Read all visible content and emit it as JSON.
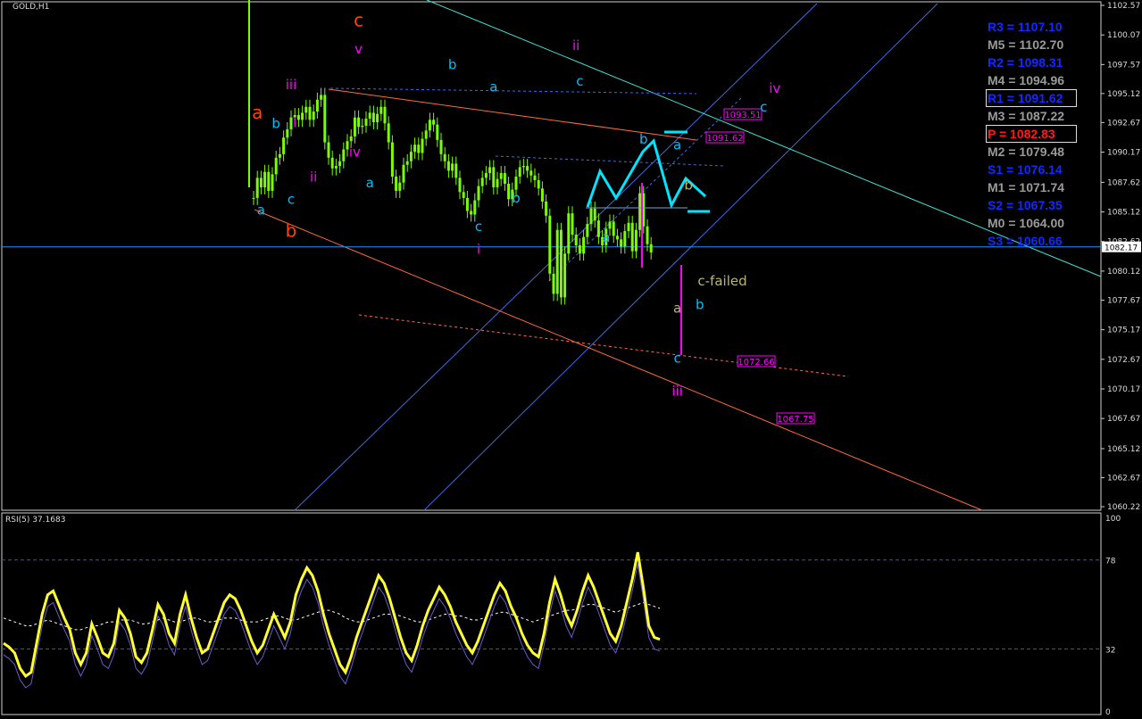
{
  "window": {
    "symbol_title": "GOLD,H1",
    "rsi_title": "RSI(5) 37.1683"
  },
  "colors": {
    "background": "#000000",
    "candle": "#7cfc00",
    "price_line": "#1e90ff",
    "channel": "#4169e1",
    "fan": "#40e0d0",
    "orange_line": "#ff6a3d",
    "wave_cyan": "#00bfff",
    "wave_magenta": "#ff00ff",
    "wave_orange": "#ff4500",
    "rsi_main": "#ffff33",
    "rsi_signal": "#6a5acd",
    "arrow": "#00e5ff"
  },
  "pivots": [
    {
      "label": "R3 = 1107.10",
      "color": "#1428ff"
    },
    {
      "label": "M5 = 1102.70",
      "color": "#9a9a9a"
    },
    {
      "label": "R2 = 1098.31",
      "color": "#1428ff"
    },
    {
      "label": "M4 = 1094.96",
      "color": "#9a9a9a"
    },
    {
      "label": "R1 = 1091.62",
      "color": "#1428ff",
      "boxed": true
    },
    {
      "label": "M3 = 1087.22",
      "color": "#9a9a9a"
    },
    {
      "label": "P = 1082.83",
      "color": "#ff1a1a",
      "boxed": true
    },
    {
      "label": "M2 = 1079.48",
      "color": "#9a9a9a"
    },
    {
      "label": "S1 = 1076.14",
      "color": "#1428ff"
    },
    {
      "label": "M1 = 1071.74",
      "color": "#9a9a9a"
    },
    {
      "label": "S2 = 1067.35",
      "color": "#1428ff"
    },
    {
      "label": "M0 = 1064.00",
      "color": "#9a9a9a"
    },
    {
      "label": "S3 = 1060.66",
      "color": "#1428ff"
    }
  ],
  "chart_data": [
    {
      "type": "candlestick",
      "title": "GOLD,H1",
      "ylim": [
        1060.22,
        1102.57
      ],
      "y_ticks": [
        "1102.57",
        "1100.07",
        "1097.57",
        "1095.12",
        "1092.67",
        "1090.17",
        "1087.62",
        "1085.12",
        "1082.62",
        "1080.12",
        "1077.67",
        "1075.17",
        "1072.67",
        "1070.17",
        "1067.67",
        "1065.12",
        "1062.67",
        "1060.22"
      ],
      "current_price": "1082.17",
      "price_tags": [
        "1093.51",
        "1091.62",
        "1072.66",
        "1067.75"
      ],
      "wave_labels": [
        {
          "text": "c",
          "color": "#ff4500",
          "price": 1100.8,
          "bar": 28
        },
        {
          "text": "v",
          "color": "#ff00ff",
          "price": 1098.5,
          "bar": 28
        },
        {
          "text": "iii",
          "color": "#ff00ff",
          "price": 1095.5,
          "bar": 10
        },
        {
          "text": "ii",
          "color": "#ff00ff",
          "price": 1098.8,
          "bar": 86
        },
        {
          "text": "a",
          "color": "#ff4500",
          "price": 1093.0,
          "bar": 1
        },
        {
          "text": "b",
          "color": "#00bfff",
          "price": 1092.2,
          "bar": 6
        },
        {
          "text": "i",
          "color": "#ff00ff",
          "price": 1092.3,
          "bar": 11
        },
        {
          "text": "iv",
          "color": "#ff00ff",
          "price": 1089.8,
          "bar": 27
        },
        {
          "text": "ii",
          "color": "#ff00ff",
          "price": 1087.7,
          "bar": 16
        },
        {
          "text": "c",
          "color": "#00bfff",
          "price": 1085.8,
          "bar": 10
        },
        {
          "text": "a",
          "color": "#00bfff",
          "price": 1084.9,
          "bar": 2
        },
        {
          "text": "b",
          "color": "#ff4500",
          "price": 1083.0,
          "bar": 10
        },
        {
          "text": "b",
          "color": "#00bfff",
          "price": 1097.2,
          "bar": 53
        },
        {
          "text": "a",
          "color": "#00bfff",
          "price": 1095.3,
          "bar": 64
        },
        {
          "text": "c",
          "color": "#00bfff",
          "price": 1095.8,
          "bar": 87
        },
        {
          "text": "a",
          "color": "#00bfff",
          "price": 1087.2,
          "bar": 31
        },
        {
          "text": "b",
          "color": "#00bfff",
          "price": 1085.9,
          "bar": 70
        },
        {
          "text": "c",
          "color": "#00bfff",
          "price": 1083.5,
          "bar": 60
        },
        {
          "text": "i",
          "color": "#ff00ff",
          "price": 1081.6,
          "bar": 60
        },
        {
          "text": "b",
          "color": "#00bfff",
          "price": 1090.9,
          "bar": 104
        },
        {
          "text": "a",
          "color": "#00bfff",
          "price": 1082.6,
          "bar": 94
        },
        {
          "text": "a",
          "color": "#00bfff",
          "price": 1090.4,
          "bar": 113
        },
        {
          "text": "b",
          "color": "#bdb76b",
          "price": 1087.0,
          "bar": 116
        },
        {
          "text": "c-failed",
          "color": "#bdb76b",
          "price": 1078.9,
          "bar": 125
        },
        {
          "text": "a",
          "color": "#bdb76b",
          "price": 1076.6,
          "bar": 113
        },
        {
          "text": "b",
          "color": "#00bfff",
          "price": 1076.9,
          "bar": 119
        },
        {
          "text": "c",
          "color": "#00bfff",
          "price": 1072.4,
          "bar": 113
        },
        {
          "text": "iii",
          "color": "#ff00ff",
          "price": 1069.6,
          "bar": 113
        },
        {
          "text": "iv",
          "color": "#ff00ff",
          "price": 1095.2,
          "bar": 139
        },
        {
          "text": "c",
          "color": "#00bfff",
          "price": 1093.6,
          "bar": 136
        }
      ],
      "candles_close_path": [
        1086.3,
        1088.0,
        1087.2,
        1088.5,
        1086.9,
        1088.3,
        1089.7,
        1090.0,
        1091.4,
        1092.1,
        1093.1,
        1093.3,
        1092.9,
        1093.5,
        1094.0,
        1092.9,
        1093.6,
        1094.6,
        1095.0,
        1091.0,
        1089.7,
        1088.8,
        1089.0,
        1089.4,
        1090.4,
        1091.1,
        1091.5,
        1093.1,
        1092.3,
        1092.4,
        1093.0,
        1093.5,
        1092.7,
        1093.4,
        1094.0,
        1092.6,
        1091.0,
        1088.1,
        1086.9,
        1087.6,
        1089.1,
        1089.4,
        1090.2,
        1090.8,
        1090.1,
        1091.3,
        1092.0,
        1092.9,
        1092.5,
        1091.2,
        1090.0,
        1089.4,
        1088.6,
        1089.2,
        1088.0,
        1086.8,
        1086.3,
        1085.2,
        1084.9,
        1086.1,
        1087.3,
        1088.0,
        1088.4,
        1088.9,
        1087.2,
        1087.9,
        1088.4,
        1087.5,
        1086.2,
        1087.0,
        1088.1,
        1088.9,
        1089.0,
        1088.6,
        1088.2,
        1087.8,
        1087.1,
        1086.0,
        1084.8,
        1079.9,
        1078.2,
        1083.6,
        1077.9,
        1081.6,
        1085.0,
        1083.2,
        1082.3,
        1081.6,
        1083.0,
        1084.1,
        1085.4,
        1084.4,
        1083.0,
        1082.3,
        1083.7,
        1084.3,
        1083.1,
        1082.8,
        1082.2,
        1083.5,
        1084.2,
        1081.8,
        1083.6,
        1086.7,
        1083.9,
        1082.4,
        1081.7
      ],
      "rsi": {
        "title": "RSI(5) 37.1683",
        "ylim": [
          0,
          100
        ],
        "levels": [
          32,
          78
        ],
        "y_ticks": [
          "100",
          "78",
          "32",
          "0"
        ],
        "values": [
          35,
          33,
          30,
          22,
          18,
          20,
          35,
          50,
          60,
          62,
          55,
          48,
          42,
          30,
          24,
          30,
          45,
          38,
          30,
          28,
          35,
          52,
          48,
          40,
          28,
          25,
          30,
          42,
          55,
          50,
          40,
          35,
          50,
          60,
          48,
          38,
          30,
          32,
          40,
          48,
          56,
          60,
          58,
          52,
          44,
          36,
          30,
          34,
          42,
          50,
          44,
          38,
          46,
          60,
          68,
          74,
          70,
          62,
          50,
          40,
          32,
          24,
          20,
          28,
          38,
          46,
          54,
          62,
          70,
          66,
          58,
          48,
          38,
          30,
          26,
          34,
          44,
          52,
          58,
          64,
          60,
          54,
          46,
          40,
          34,
          30,
          36,
          44,
          52,
          60,
          66,
          62,
          54,
          48,
          40,
          34,
          30,
          28,
          40,
          56,
          68,
          60,
          50,
          44,
          52,
          62,
          70,
          64,
          56,
          48,
          40,
          36,
          44,
          56,
          68,
          82,
          64,
          44,
          38,
          37
        ],
        "ma": [
          48,
          47,
          46,
          45,
          44,
          44,
          45,
          46,
          47,
          46,
          45,
          44,
          43,
          42,
          42,
          43,
          44,
          44,
          45,
          46,
          46,
          47,
          47,
          47,
          46,
          45,
          45,
          46,
          47,
          48,
          47,
          46,
          46,
          47,
          48,
          48,
          47,
          46,
          46,
          47,
          48,
          48,
          48,
          47,
          46,
          46,
          46,
          47,
          48,
          49,
          49,
          48,
          47,
          47,
          48,
          49,
          50,
          51,
          52,
          52,
          51,
          50,
          48,
          47,
          46,
          46,
          47,
          48,
          49,
          50,
          50,
          50,
          49,
          48,
          47,
          46,
          46,
          47,
          48,
          49,
          50,
          50,
          49,
          49,
          48,
          47,
          47,
          48,
          49,
          50,
          51,
          51,
          50,
          49,
          48,
          47,
          46,
          47,
          48,
          49,
          50,
          51,
          52,
          52,
          53,
          54,
          55,
          55,
          54,
          53,
          52,
          51,
          52,
          53,
          54,
          55,
          56,
          55,
          54,
          53
        ]
      }
    }
  ]
}
